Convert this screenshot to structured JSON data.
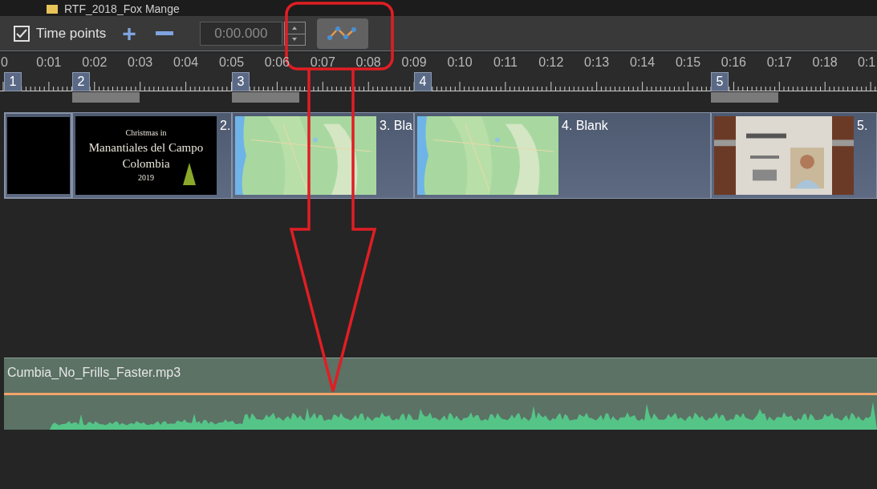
{
  "top_strip": {
    "item": "RTF_2018_Fox Mange"
  },
  "toolbar": {
    "time_points": {
      "label": "Time points",
      "checked": true
    },
    "add": "+",
    "time_field": {
      "value": "0:00.000"
    }
  },
  "ruler": {
    "labels": [
      "0",
      "0:01",
      "0:02",
      "0:03",
      "0:04",
      "0:05",
      "0:06",
      "0:07",
      "0:08",
      "0:09",
      "0:10",
      "0:11",
      "0:12",
      "0:13",
      "0:14",
      "0:15",
      "0:16",
      "0:17",
      "0:18",
      "0:1"
    ],
    "markers": [
      {
        "number": "1",
        "bar": false
      },
      {
        "number": "2",
        "bar": true
      },
      {
        "number": "3",
        "bar": true
      },
      {
        "number": "4",
        "bar": false
      },
      {
        "number": "5",
        "bar": true
      }
    ]
  },
  "slides": [
    {
      "kind": "black"
    },
    {
      "kind": "title",
      "caption": "2.",
      "title_lines": [
        "Christmas in",
        "Manantiales del Campo",
        "Colombia",
        "2019"
      ]
    },
    {
      "kind": "map",
      "caption": "3. Bla"
    },
    {
      "kind": "map",
      "caption": "4. Blank"
    },
    {
      "caption": "5."
    }
  ],
  "audio": {
    "filename": "Cumbia_No_Frills_Faster.mp3"
  }
}
